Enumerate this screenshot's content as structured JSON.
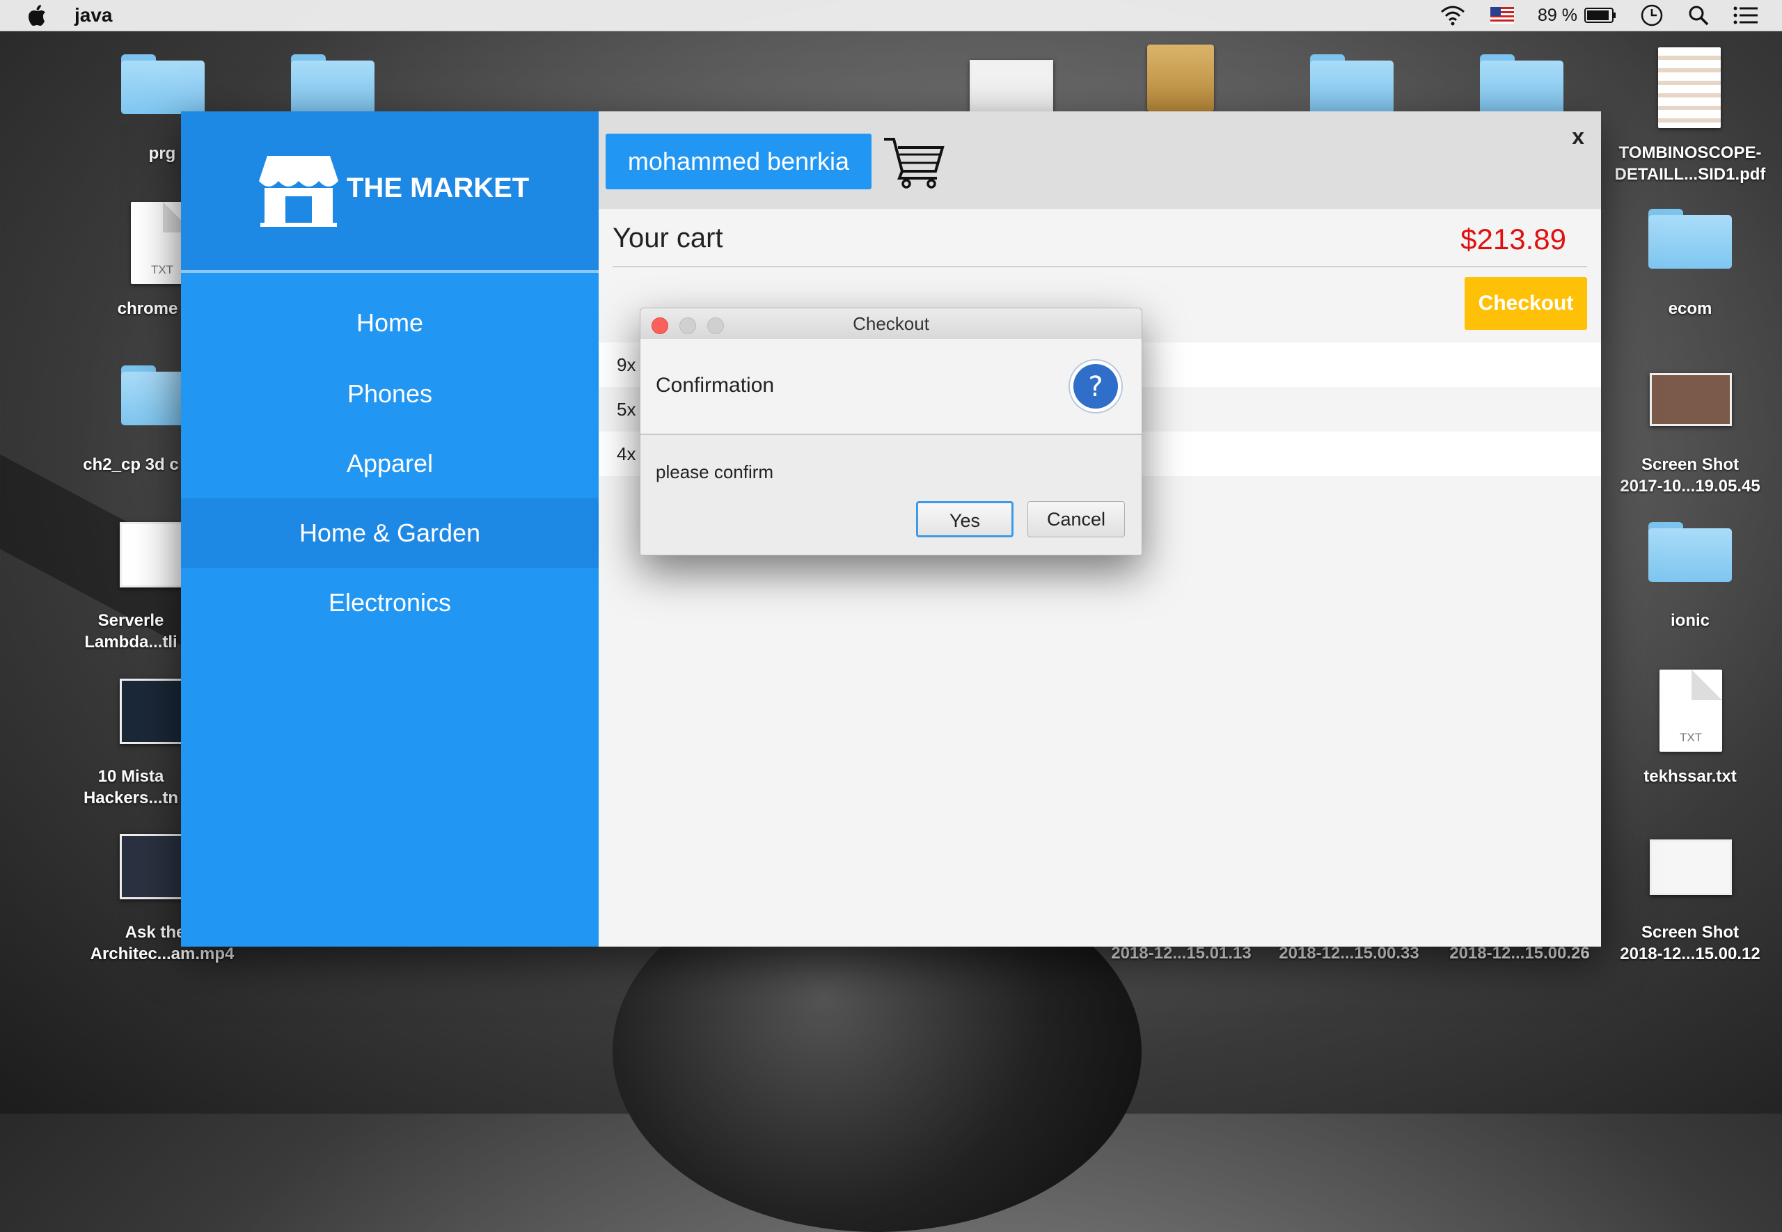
{
  "menubar": {
    "app_name": "java",
    "battery_percent": "89 %"
  },
  "desktop": {
    "left_icons": [
      {
        "label": "prg"
      },
      {
        "label": "chrome"
      },
      {
        "label": "ch2_cp 3d c"
      },
      {
        "label": "Serverle\nLambda...tli"
      },
      {
        "label": "10 Mista\nHackers...tn"
      },
      {
        "label": "Ask the J\nArchitec...am.mp4"
      }
    ],
    "right_icons": [
      {
        "label": "TOMBINOSCOPE-\nDETAILL...SID1.pdf"
      },
      {
        "label": "ecom"
      },
      {
        "label": "Screen Shot\n2017-10...19.05.45"
      },
      {
        "label": "ionic"
      },
      {
        "label": "tekhssar.txt"
      },
      {
        "label": "Screen Shot\n2018-12...15.00.12"
      }
    ],
    "bottom_labels": [
      "2018-12...15.01.13",
      "2018-12...15.00.33",
      "2018-12...15.00.26"
    ],
    "txt_ext": "TXT"
  },
  "app": {
    "logo_text": "THE MARKET",
    "nav": [
      {
        "label": "Home"
      },
      {
        "label": "Phones"
      },
      {
        "label": "Apparel"
      },
      {
        "label": "Home & Garden"
      },
      {
        "label": "Electronics"
      }
    ],
    "active_nav": "Home & Garden",
    "user_name": "mohammed benrkia",
    "close_label": "x",
    "cart_title": "Your cart",
    "cart_total": "$213.89",
    "checkout_label": "Checkout",
    "cart_items": [
      {
        "qty": "9x"
      },
      {
        "qty": "5x"
      },
      {
        "qty": "4x"
      }
    ]
  },
  "dialog": {
    "title": "Checkout",
    "header": "Confirmation",
    "message": "please confirm",
    "yes_label": "Yes",
    "cancel_label": "Cancel"
  },
  "colors": {
    "sidebar": "#2196f3",
    "sidebar_header": "#1e88e5",
    "checkout": "#ffc107",
    "total": "#e01010"
  }
}
